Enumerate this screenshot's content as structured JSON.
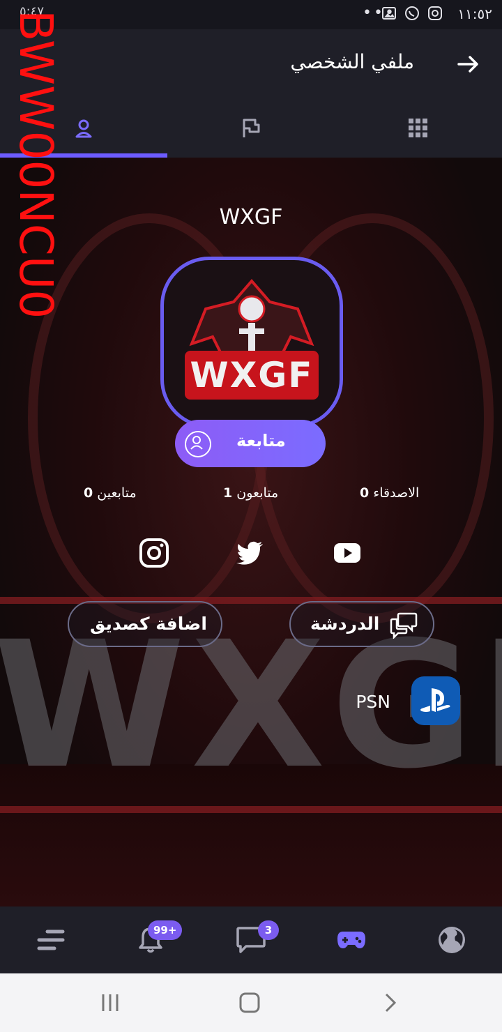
{
  "status_bar": {
    "time": "١١:٥٢",
    "left_text": "٥:٤٧",
    "more": "•••"
  },
  "header": {
    "title": "ملفي الشخصي",
    "back_icon": "arrow-right-icon"
  },
  "tabs": [
    {
      "name": "profile",
      "icon": "user-icon",
      "active": true
    },
    {
      "name": "flag",
      "icon": "flag-icon",
      "active": false
    },
    {
      "name": "grid",
      "icon": "grid-icon",
      "active": false
    }
  ],
  "profile": {
    "username": "WXGF",
    "avatar_text": "WXGF",
    "follow_label": "متابعة",
    "stats": {
      "friends": {
        "count": "0",
        "label": "الاصدقاء"
      },
      "followers": {
        "count": "1",
        "label": "متابعون"
      },
      "following": {
        "count": "0",
        "label": "متابعين"
      }
    },
    "chat_label": "الدردشة",
    "add_friend_label": "اضافة كصديق",
    "platform_label": "PSN"
  },
  "hero_text": "WXGF",
  "bottom_nav": {
    "notifications_badge": "99+",
    "messages_badge": "3"
  },
  "watermark": "BWW00NCU0",
  "colors": {
    "accent": "#6d5cff",
    "header_bg": "#1f1f28",
    "psn_blue": "#0f5bb5",
    "watermark": "#ff1010"
  }
}
